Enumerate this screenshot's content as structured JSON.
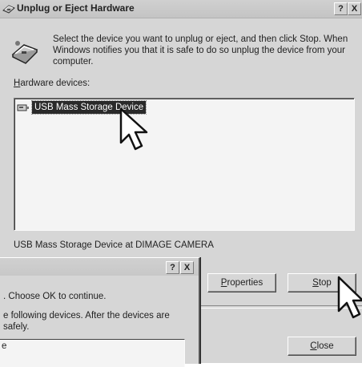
{
  "dialog": {
    "title": "Unplug or Eject Hardware",
    "help_label": "?",
    "close_label": "X",
    "instruction": "Select the device you want to unplug or eject, and then click Stop. When Windows notifies you that it is safe to do so unplug the device from your computer.",
    "hardware_label_key": "H",
    "hardware_label_rest": "ardware devices:",
    "devices": [
      {
        "label": "USB Mass Storage Device",
        "selected": true
      }
    ],
    "status": "USB Mass Storage Device at DIMAGE CAMERA",
    "buttons": {
      "properties_key": "P",
      "properties_rest": "roperties",
      "stop_key": "S",
      "stop_rest": "top",
      "close_key": "C",
      "close_rest": "lose"
    }
  },
  "dialog2": {
    "help_label": "?",
    "close_label": "X",
    "text1": ". Choose OK to continue.",
    "text2": "e following devices. After the devices are safely.",
    "list_item": "e"
  },
  "colors": {
    "selection": "#2a2a2a",
    "face": "#d6d6d6",
    "list_bg": "#f4f4f4"
  },
  "icons": [
    "hardware-icon",
    "usb-device-icon",
    "mouse-pointer-icon"
  ]
}
